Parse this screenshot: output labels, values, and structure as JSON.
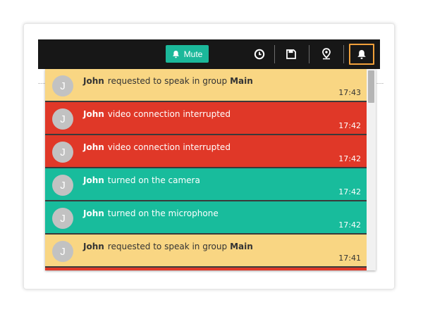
{
  "toolbar": {
    "mute_label": "Mute",
    "icons": [
      "history-clock-icon",
      "save-floppy-icon",
      "location-pin-icon",
      "notifications-bell-icon"
    ],
    "active_icon": "notifications-bell-icon"
  },
  "colors": {
    "topbar": "#171717",
    "mute_button": "#1bb89a",
    "active_outline": "#f0a03a",
    "request": "#f9d683",
    "error": "#e03828",
    "success": "#18bc9c"
  },
  "notifications": [
    {
      "type": "request",
      "avatar": "J",
      "name": "John",
      "text": "requested to speak in group",
      "group": "Main",
      "time": "17:43"
    },
    {
      "type": "error",
      "avatar": "J",
      "name": "John",
      "text": "video connection interrupted",
      "group": "",
      "time": "17:42"
    },
    {
      "type": "error",
      "avatar": "J",
      "name": "John",
      "text": "video connection interrupted",
      "group": "",
      "time": "17:42"
    },
    {
      "type": "success",
      "avatar": "J",
      "name": "John",
      "text": "turned on the camera",
      "group": "",
      "time": "17:42"
    },
    {
      "type": "success",
      "avatar": "J",
      "name": "John",
      "text": "turned on the microphone",
      "group": "",
      "time": "17:42"
    },
    {
      "type": "request",
      "avatar": "J",
      "name": "John",
      "text": "requested to speak in group",
      "group": "Main",
      "time": "17:41"
    }
  ],
  "partial_next_type": "error"
}
